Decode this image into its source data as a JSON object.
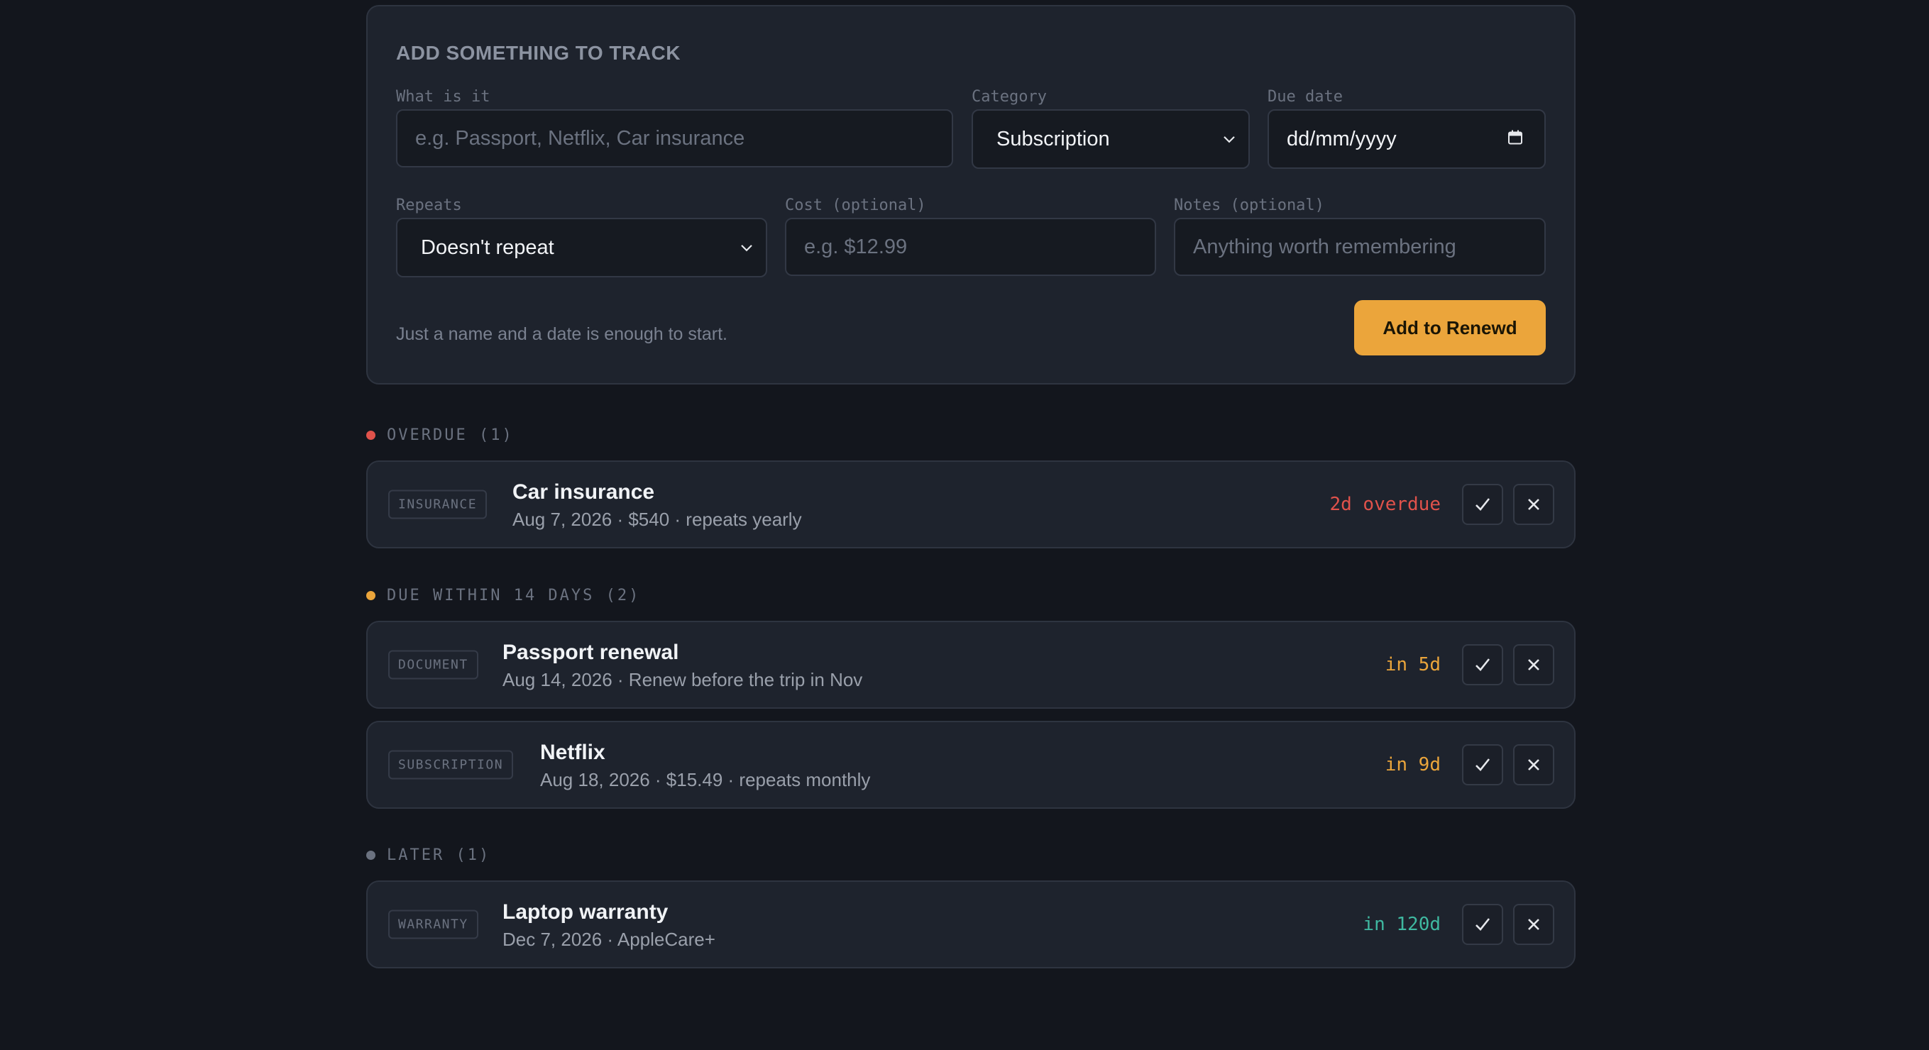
{
  "form": {
    "title": "ADD SOMETHING TO TRACK",
    "what_label": "What is it",
    "what_placeholder": "e.g. Passport, Netflix, Car insurance",
    "category_label": "Category",
    "category_value": "Subscription",
    "due_label": "Due date",
    "due_value": "dd/mm/yyyy",
    "repeats_label": "Repeats",
    "repeats_value": "Doesn't repeat",
    "cost_label": "Cost (optional)",
    "cost_placeholder": "e.g. $12.99",
    "notes_label": "Notes (optional)",
    "notes_placeholder": "Anything worth remembering",
    "hint": "Just a name and a date is enough to start.",
    "submit_label": "Add to Renewd"
  },
  "sections": [
    {
      "heading": "OVERDUE (1)",
      "color": "#e0524b",
      "items": [
        {
          "badge": "INSURANCE",
          "title": "Car insurance",
          "sub": "Aug 7, 2026 · $540 · repeats yearly",
          "due": "2d overdue",
          "due_color": "#e0524b"
        }
      ]
    },
    {
      "heading": "DUE WITHIN 14 DAYS (2)",
      "color": "#eba53b",
      "items": [
        {
          "badge": "DOCUMENT",
          "title": "Passport renewal",
          "sub": "Aug 14, 2026 · Renew before the trip in Nov",
          "due": "in 5d",
          "due_color": "#eba53b"
        },
        {
          "badge": "SUBSCRIPTION",
          "title": "Netflix",
          "sub": "Aug 18, 2026 · $15.49 · repeats monthly",
          "due": "in 9d",
          "due_color": "#eba53b"
        }
      ]
    },
    {
      "heading": "LATER (1)",
      "color": "#6b7280",
      "items": [
        {
          "badge": "WARRANTY",
          "title": "Laptop warranty",
          "sub": "Dec 7, 2026 · AppleCare+",
          "due": "in 120d",
          "due_color": "#3fb8a0"
        }
      ]
    }
  ],
  "icons": {
    "check": "check-icon",
    "close": "close-icon",
    "chevron": "chevron-down-icon",
    "calendar": "calendar-icon"
  }
}
